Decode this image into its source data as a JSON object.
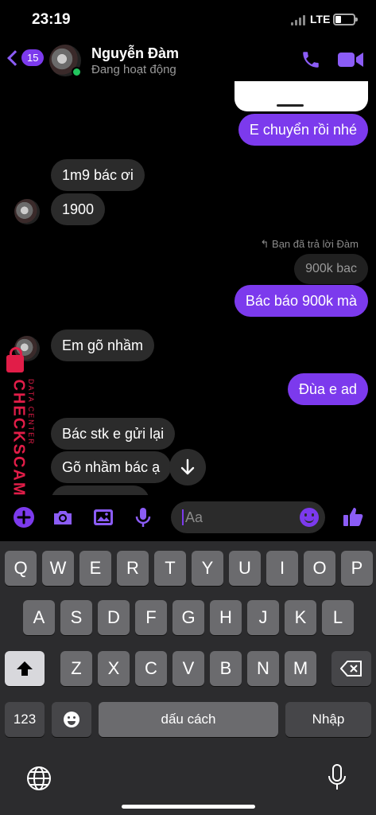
{
  "status_bar": {
    "time": "23:19",
    "network": "LTE",
    "battery_level": 0.3
  },
  "header": {
    "back_count": "15",
    "contact_name": "Nguyễn Đàm",
    "contact_status": "Đang hoạt động"
  },
  "messages": [
    {
      "text": "E chuyển rồi nhé"
    },
    {
      "text": "1m9 bác ơi"
    },
    {
      "text": "1900"
    },
    {
      "text": "Bạn đã trả lời Đàm"
    },
    {
      "text": "900k bac"
    },
    {
      "text": "Bác báo 900k mà"
    },
    {
      "text": "Em gõ nhầm"
    },
    {
      "text": "Đùa e ad"
    },
    {
      "text": "Bác stk e gửi lại"
    },
    {
      "text": "Gõ nhầm bác ạ"
    }
  ],
  "watermark": {
    "brand": "CHECKSCAM.VN",
    "sub": "DATA CENTER"
  },
  "composer": {
    "placeholder": "Aa"
  },
  "keyboard": {
    "row1": [
      "Q",
      "W",
      "E",
      "R",
      "T",
      "Y",
      "U",
      "I",
      "O",
      "P"
    ],
    "row2": [
      "A",
      "S",
      "D",
      "F",
      "G",
      "H",
      "J",
      "K",
      "L"
    ],
    "row3": [
      "Z",
      "X",
      "C",
      "V",
      "B",
      "N",
      "M"
    ],
    "numbers_label": "123",
    "space_label": "dấu cách",
    "return_label": "Nhập"
  },
  "colors": {
    "accent": "#7c3aed",
    "incoming_bubble": "#2b2b2b",
    "keyboard_bg": "#2c2c2e",
    "watermark": "#e11d48"
  }
}
